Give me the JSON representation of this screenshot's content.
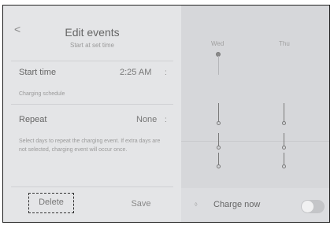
{
  "header": {
    "back_icon": "<",
    "title": "Edit events",
    "subtitle": "Start at set time"
  },
  "start_time": {
    "label": "Start time",
    "value": "2:25 AM",
    "menu_icon": ":"
  },
  "charging_schedule_label": "Charging schedule",
  "repeat": {
    "label": "Repeat",
    "value": "None",
    "menu_icon": ":",
    "description": "Select days to repeat the charging event. If extra days are not selected, charging event will occur once."
  },
  "actions": {
    "delete_label": "Delete",
    "save_label": "Save"
  },
  "schedule": {
    "days": [
      "Wed",
      "Thu"
    ]
  },
  "charge_now": {
    "icon": "◊",
    "label": "Charge now",
    "toggle_on": false
  }
}
